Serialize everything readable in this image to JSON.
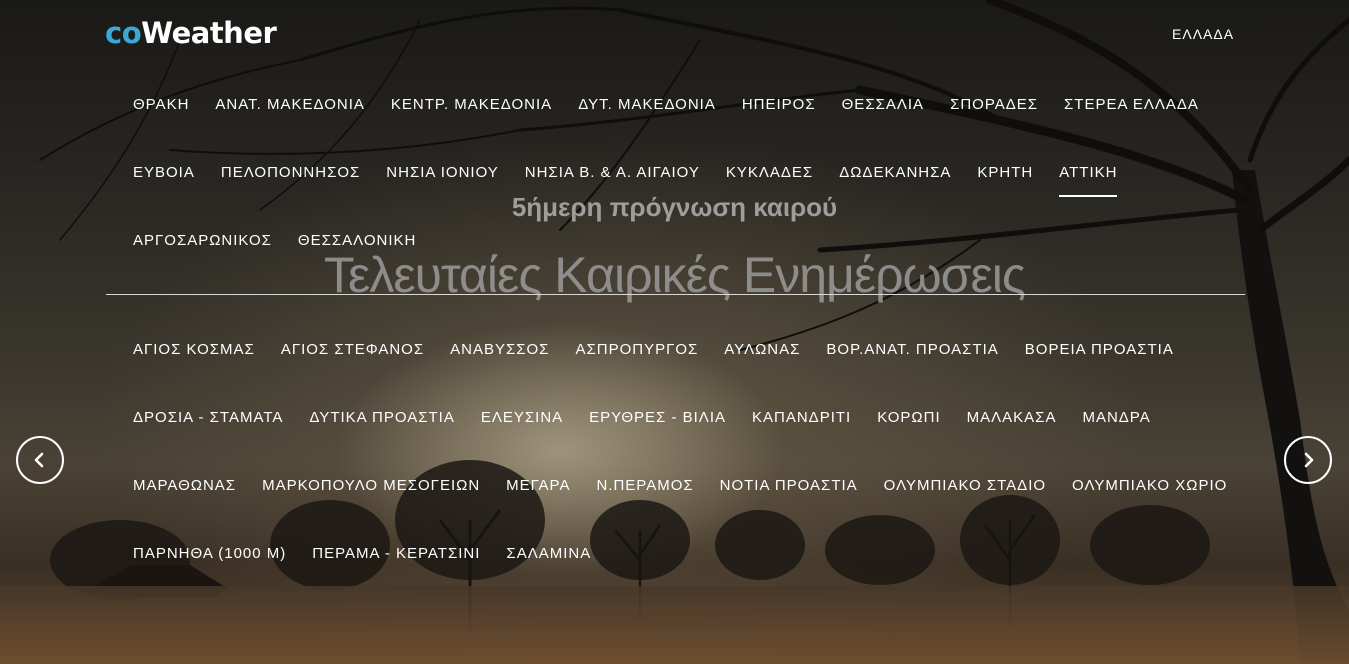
{
  "header": {
    "logo_prefix": "co",
    "logo_suffix": "Weather",
    "country": "ΕΛΛΑΔΑ"
  },
  "regions": {
    "row1": [
      "ΘΡΑΚΗ",
      "ΑΝΑΤ. ΜΑΚΕΔΟΝΙΑ",
      "ΚΕΝΤΡ. ΜΑΚΕΔΟΝΙΑ",
      "ΔΥΤ. ΜΑΚΕΔΟΝΙΑ",
      "ΗΠΕΙΡΟΣ",
      "ΘΕΣΣΑΛΙΑ",
      "ΣΠΟΡΑΔΕΣ",
      "ΣΤΕΡΕΑ ΕΛΛΑΔΑ"
    ],
    "row2": [
      "ΕΥΒΟΙΑ",
      "ΠΕΛΟΠΟΝΝΗΣΟΣ",
      "ΝΗΣΙΑ ΙΟΝΙΟΥ",
      "ΝΗΣΙΑ Β. & Α. ΑΙΓΑΙΟΥ",
      "ΚΥΚΛΑΔΕΣ",
      "ΔΩΔΕΚΑΝΗΣΑ",
      "ΚΡΗΤΗ",
      "ΑΤΤΙΚΗ"
    ],
    "row3": [
      "ΑΡΓΟΣΑΡΩΝΙΚΟΣ",
      "ΘΕΣΣΑΛΟΝΙΚΗ"
    ],
    "active": "ΑΤΤΙΚΗ"
  },
  "hero": {
    "subtitle": "5ήμερη πρόγνωση καιρού",
    "headline": "Τελευταίες Καιρικές Ενημέρωσεις"
  },
  "areas": {
    "row1": [
      "ΑΓΙΟΣ ΚΟΣΜΑΣ",
      "ΑΓΙΟΣ ΣΤΕΦΑΝΟΣ",
      "ΑΝΑΒΥΣΣΟΣ",
      "ΑΣΠΡΟΠΥΡΓΟΣ",
      "ΑΥΛΩΝΑΣ",
      "ΒΟΡ.ΑΝΑΤ. ΠΡΟΑΣΤΙΑ",
      "ΒΟΡΕΙΑ ΠΡΟΑΣΤΙΑ"
    ],
    "row2": [
      "ΔΡΟΣΙΑ - ΣΤΑΜΑΤΑ",
      "ΔΥΤΙΚΑ ΠΡΟΑΣΤΙΑ",
      "ΕΛΕΥΣΙΝΑ",
      "ΕΡΥΘΡΕΣ - ΒΙΛΙΑ",
      "ΚΑΠΑΝΔΡΙΤΙ",
      "ΚΟΡΩΠΙ",
      "ΜΑΛΑΚΑΣΑ",
      "ΜΑΝΔΡΑ"
    ],
    "row3": [
      "ΜΑΡΑΘΩΝΑΣ",
      "ΜΑΡΚΟΠΟΥΛΟ ΜΕΣΟΓΕΙΩΝ",
      "ΜΕΓΑΡΑ",
      "Ν.ΠΕΡΑΜΟΣ",
      "ΝΟΤΙΑ ΠΡΟΑΣΤΙΑ",
      "ΟΛΥΜΠΙΑΚΟ ΣΤΑΔΙΟ",
      "ΟΛΥΜΠΙΑΚΟ ΧΩΡΙΟ"
    ],
    "row4": [
      "ΠΑΡΝΗΘΑ (1000 Μ)",
      "ΠΕΡΑΜΑ - ΚΕΡΑΤΣΙΝΙ",
      "ΣΑΛΑΜΙΝΑ"
    ]
  },
  "carousel": {
    "prev_icon": "chevron-left-icon",
    "next_icon": "chevron-right-icon"
  },
  "colors": {
    "brand_accent": "#3aa9d6",
    "text": "#ffffff"
  }
}
